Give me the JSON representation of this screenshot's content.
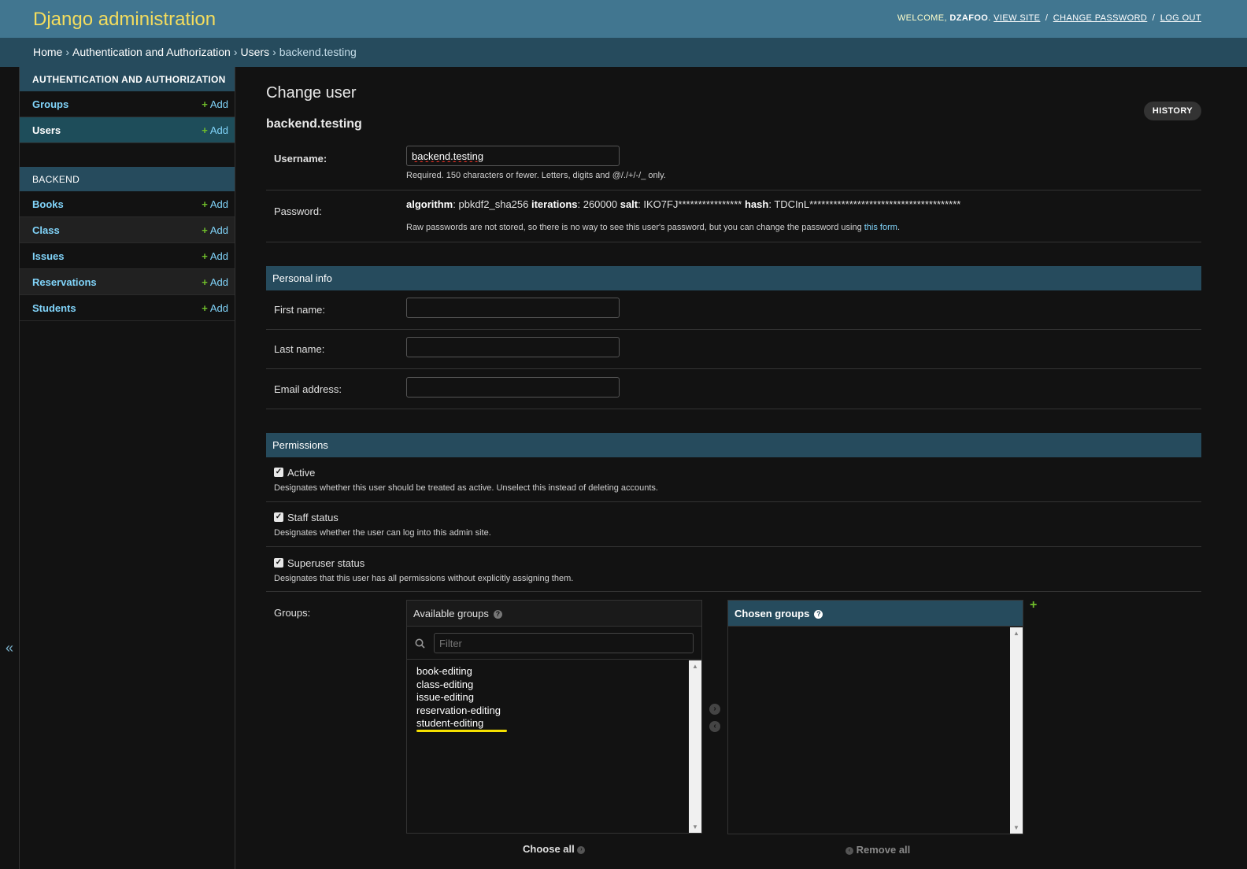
{
  "header": {
    "brand": "Django administration",
    "welcome": "WELCOME,",
    "username": "DZAFOO",
    "username_suffix": ".",
    "view_site": "VIEW SITE",
    "change_password": "CHANGE PASSWORD",
    "log_out": "LOG OUT",
    "sep": "/"
  },
  "breadcrumbs": {
    "items": [
      "Home",
      "Authentication and Authorization",
      "Users",
      "backend.testing"
    ],
    "arrow": "›"
  },
  "sidebar": {
    "modules": [
      {
        "caption": "AUTHENTICATION AND AUTHORIZATION",
        "models": [
          {
            "name": "Groups",
            "add": "Add"
          },
          {
            "name": "Users",
            "add": "Add",
            "current": true
          }
        ]
      },
      {
        "caption": "BACKEND",
        "models": [
          {
            "name": "Books",
            "add": "Add"
          },
          {
            "name": "Class",
            "add": "Add"
          },
          {
            "name": "Issues",
            "add": "Add"
          },
          {
            "name": "Reservations",
            "add": "Add"
          },
          {
            "name": "Students",
            "add": "Add"
          }
        ]
      }
    ],
    "collapse_glyph": "«"
  },
  "content": {
    "title": "Change user",
    "subtitle": "backend.testing",
    "history": "HISTORY",
    "username": {
      "label": "Username:",
      "value": "backend.testing",
      "help": "Required. 150 characters or fewer. Letters, digits and @/./+/-/_ only."
    },
    "password": {
      "label": "Password:",
      "algorithm_label": "algorithm",
      "algorithm": ": pbkdf2_sha256 ",
      "iterations_label": "iterations",
      "iterations": ": 260000 ",
      "salt_label": "salt",
      "salt": ": IKO7FJ**************** ",
      "hash_label": "hash",
      "hash": ": TDCInL**************************************",
      "help_before": "Raw passwords are not stored, so there is no way to see this user's password, but you can change the password using ",
      "help_link": "this form",
      "help_after": "."
    },
    "personal_info": {
      "caption": "Personal info",
      "first_name_label": "First name:",
      "first_name_value": "",
      "last_name_label": "Last name:",
      "last_name_value": "",
      "email_label": "Email address:",
      "email_value": ""
    },
    "permissions": {
      "caption": "Permissions",
      "active": {
        "label": "Active",
        "checked": true,
        "help": "Designates whether this user should be treated as active. Unselect this instead of deleting accounts."
      },
      "staff": {
        "label": "Staff status",
        "checked": true,
        "help": "Designates whether the user can log into this admin site."
      },
      "superuser": {
        "label": "Superuser status",
        "checked": true,
        "help": "Designates that this user has all permissions without explicitly assigning them."
      },
      "groups": {
        "label": "Groups:",
        "available_title": "Available groups",
        "chosen_title": "Chosen groups",
        "filter_placeholder": "Filter",
        "available": [
          "book-editing",
          "class-editing",
          "issue-editing",
          "reservation-editing",
          "student-editing"
        ],
        "chosen": [],
        "choose_all": "Choose all",
        "remove_all": "Remove all",
        "help_glyph": "?"
      }
    }
  }
}
